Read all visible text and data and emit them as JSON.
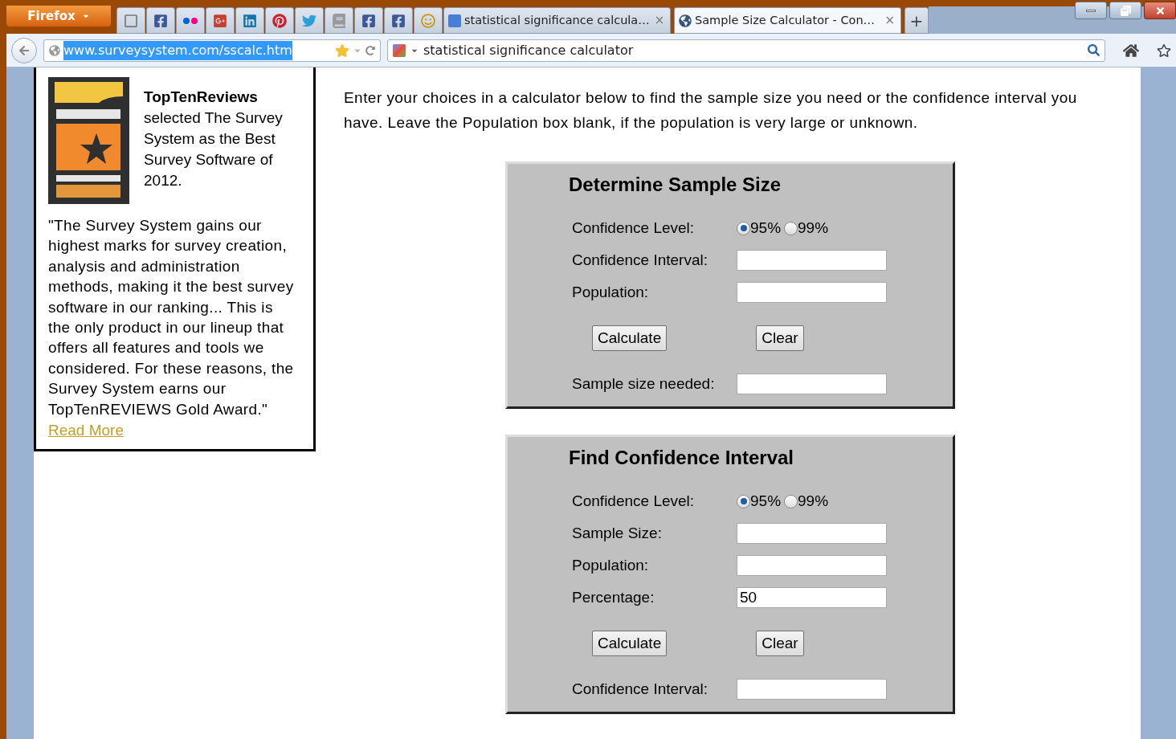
{
  "browser": {
    "menu_button": "Firefox",
    "tabs": [
      {
        "title": "statistical significance calcula…",
        "close": "×",
        "selected": false
      },
      {
        "title": "Sample Size Calculator - Con…",
        "close": "×",
        "selected": true
      }
    ],
    "new_tab": "+",
    "url": "www.surveysystem.com/sscalc.htm",
    "search": "statistical significance calculator"
  },
  "sidebar": {
    "award_title": "TopTenReviews",
    "award_text": "selected The Survey System as the Best Survey Software of 2012.",
    "quote": "\"The Survey System gains our highest marks for survey creation, analysis and administration methods, making it the best survey software in our ranking... This is the only product in our lineup that offers all features and tools we considered. For these reasons, the Survey System earns our TopTenREVIEWS Gold Award.\"",
    "link": "Read More"
  },
  "intro": "Enter your choices in a calculator below to find the sample size you need or the confidence interval you have. Leave the Population box blank, if the population is very large or unknown.",
  "calculators": [
    {
      "title": "Determine Sample Size",
      "rows": [
        {
          "kind": "radio",
          "label": "Confidence Level:",
          "options": [
            {
              "label": "95%",
              "selected": true
            },
            {
              "label": "99%",
              "selected": false
            }
          ]
        },
        {
          "kind": "field",
          "label": "Confidence Interval:"
        },
        {
          "kind": "field",
          "label": "Population:"
        },
        {
          "kind": "buttons",
          "buttons": [
            "Calculate",
            "Clear"
          ]
        },
        {
          "kind": "field",
          "label": "Sample size needed:"
        }
      ]
    },
    {
      "title": "Find Confidence Interval",
      "rows": [
        {
          "kind": "radio",
          "label": "Confidence Level:",
          "options": [
            {
              "label": "95%",
              "selected": true
            },
            {
              "label": "99%",
              "selected": false
            }
          ]
        },
        {
          "kind": "field",
          "label": "Sample Size:"
        },
        {
          "kind": "field",
          "label": "Population:"
        },
        {
          "kind": "field",
          "label": "Percentage:",
          "value": "50"
        },
        {
          "kind": "buttons",
          "buttons": [
            "Calculate",
            "Clear"
          ]
        },
        {
          "kind": "field",
          "label": "Confidence Interval:"
        }
      ]
    }
  ]
}
